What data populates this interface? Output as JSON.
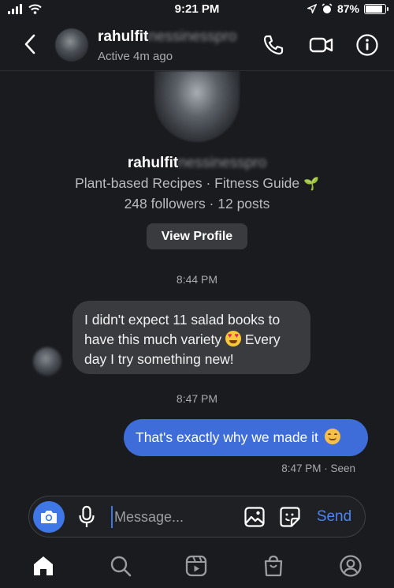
{
  "status_bar": {
    "time": "9:21 PM",
    "battery": "87%",
    "battery_level": 0.87
  },
  "header": {
    "username_visible": "rahulfit",
    "username_blurred": "nessinesspro",
    "status": "Active 4m ago",
    "icons": [
      "back-icon",
      "phone-icon",
      "video-icon",
      "info-icon"
    ]
  },
  "profile": {
    "username_visible": "rahulfit",
    "username_blurred": "nessinesspro",
    "bio": "Plant-based Recipes · Fitness Guide",
    "bio_emoji": "🌱",
    "stats": "248 followers · 12 posts",
    "view_profile_label": "View Profile"
  },
  "messages": [
    {
      "timestamp": "8:44 PM"
    },
    {
      "direction": "incoming",
      "text_part1": "I didn't expect 11 salad books to have this much variety",
      "text_part2": "Every day I try something new!"
    },
    {
      "timestamp": "8:47 PM"
    },
    {
      "direction": "outgoing",
      "text": "That's exactly why we made it",
      "receipt": "8:47 PM · Seen"
    }
  ],
  "composer": {
    "placeholder": "Message...",
    "send_label": "Send"
  },
  "tabbar": [
    "home-icon",
    "search-icon",
    "reels-icon",
    "shop-icon",
    "profile-icon"
  ],
  "colors": {
    "background": "#1a1b1f",
    "bubble_in": "#3a3b3f",
    "bubble_out": "#3e6cd8",
    "accent": "#3f78e6",
    "send": "#4a86f0"
  }
}
